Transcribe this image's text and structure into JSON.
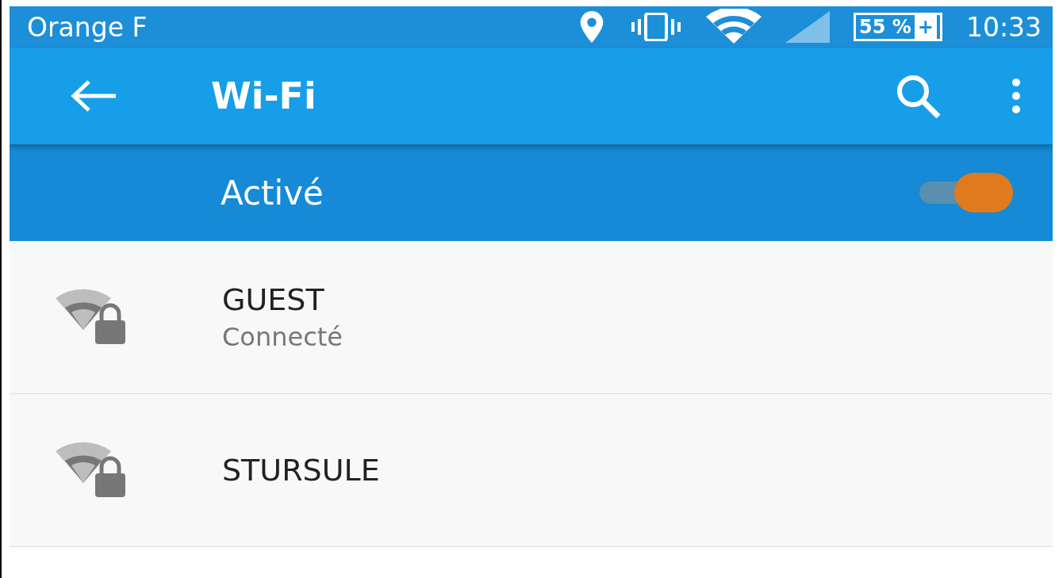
{
  "status_bar": {
    "carrier": "Orange F",
    "battery": "55 %",
    "battery_plus": "+",
    "time": "10:33"
  },
  "toolbar": {
    "title": "Wi-Fi"
  },
  "master_switch": {
    "label": "Activé",
    "on": true
  },
  "networks": [
    {
      "name": "GUEST",
      "status": "Connecté",
      "locked": true
    },
    {
      "name": "STURSULE",
      "locked": true
    }
  ]
}
